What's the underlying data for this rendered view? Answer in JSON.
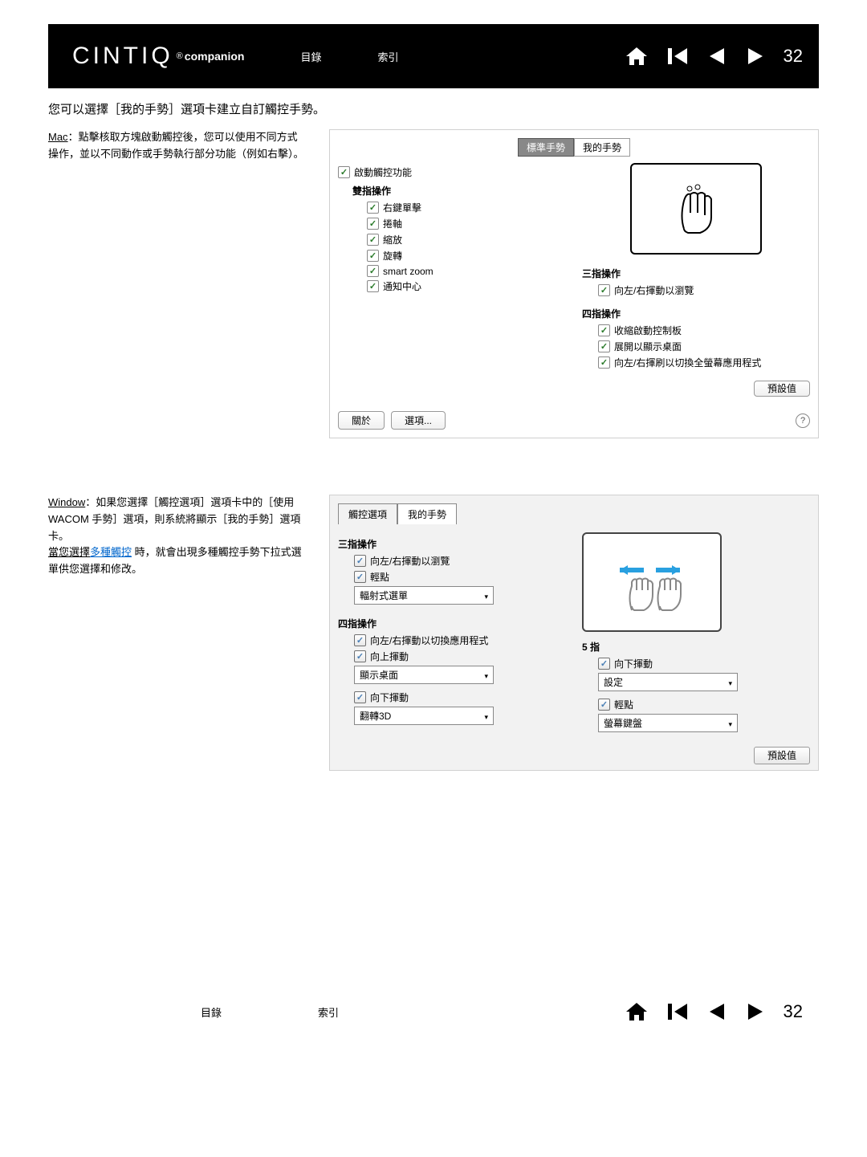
{
  "brand": {
    "name": "CINTIQ",
    "reg": "®",
    "sub": "companion"
  },
  "nav": {
    "toc": "目錄",
    "index": "索引"
  },
  "page": "32",
  "intro": "您可以選擇［我的手勢］選項卡建立自訂觸控手勢。",
  "mac": {
    "label": "Mac",
    "text": "：點擊核取方塊啟動觸控後，您可以使用不同方式操作，並以不同動作或手勢執行部分功能（例如右擊）。",
    "tab_std": "標準手勢",
    "tab_my": "我的手勢",
    "enable": "啟動觸控功能",
    "two": "雙指操作",
    "items2": [
      "右鍵單擊",
      "捲軸",
      "縮放",
      "旋轉",
      "smart zoom",
      "通知中心"
    ],
    "three": "三指操作",
    "three_item": "向左/右揮動以瀏覽",
    "four": "四指操作",
    "four_items": [
      "收縮啟動控制板",
      "展開以顯示桌面",
      "向左/右揮刷以切換全螢幕應用程式"
    ],
    "default": "預設值",
    "about": "關於",
    "opts": "選項..."
  },
  "win": {
    "label": "Window",
    "text": "：如果您選擇［觸控選項］選項卡中的［使用 WACOM 手勢］選項，則系統將顯示［我的手勢］選項卡。",
    "text2a": "當您選擇",
    "link": "多種觸控",
    "text2b": " 時，就會出現多種觸控手勢下拉式選單供您選擇和修改。",
    "tab_opt": "觸控選項",
    "tab_my": "我的手勢",
    "three": "三指操作",
    "t3a": "向左/右揮動以瀏覽",
    "t3b": "輕點",
    "t3sel": "輻射式選單",
    "four": "四指操作",
    "t4a": "向左/右揮動以切換應用程式",
    "t4b": "向上揮動",
    "t4sel1": "顯示桌面",
    "t4c": "向下揮動",
    "t4sel2": "翻轉3D",
    "five": "5 指",
    "t5a": "向下揮動",
    "t5sel1": "設定",
    "t5b": "輕點",
    "t5sel2": "螢幕鍵盤",
    "default": "預設值"
  }
}
